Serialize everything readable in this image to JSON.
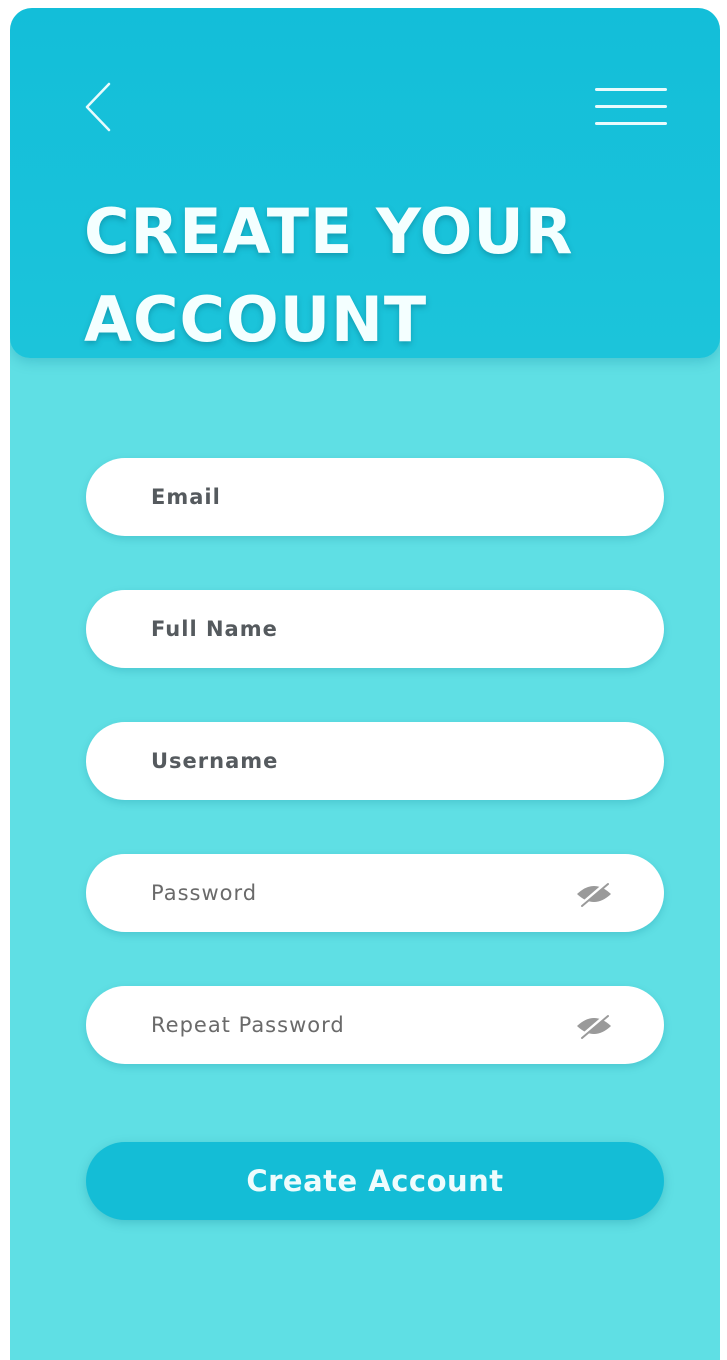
{
  "header": {
    "title_line1": "CREATE YOUR",
    "title_line2": "ACCOUNT",
    "back_icon": "chevron-left-icon",
    "menu_icon": "hamburger-menu-icon"
  },
  "form": {
    "fields": [
      {
        "label": "Email",
        "type": "text"
      },
      {
        "label": "Full Name",
        "type": "text"
      },
      {
        "label": "Username",
        "type": "text"
      },
      {
        "label": "Password",
        "type": "password",
        "icon": "eye-slash-icon"
      },
      {
        "label": "Repeat Password",
        "type": "password",
        "icon": "eye-slash-icon"
      }
    ],
    "submit_label": "Create Account"
  },
  "colors": {
    "background": "#5fdfe4",
    "header": "#13bed9",
    "button": "#14bdd6",
    "field": "#ffffff"
  }
}
